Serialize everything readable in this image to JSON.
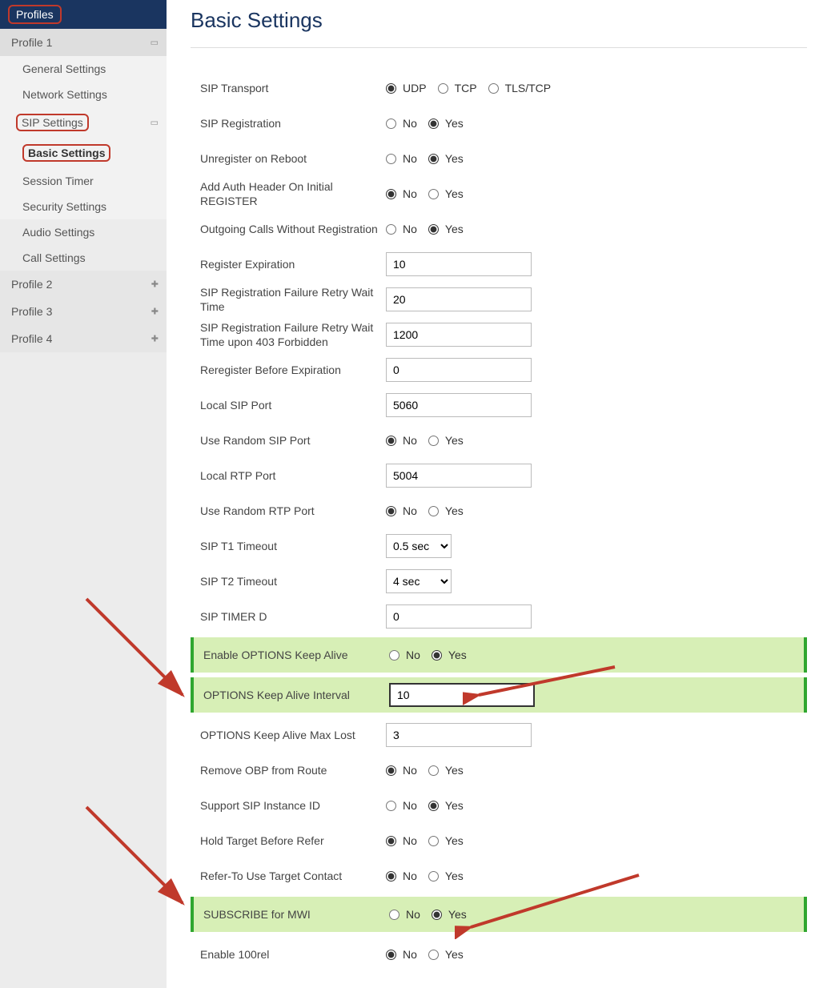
{
  "sidebar": {
    "header": "Profiles",
    "profile1": "Profile 1",
    "general": "General Settings",
    "network": "Network Settings",
    "sip": "SIP Settings",
    "basic": "Basic Settings",
    "session": "Session Timer",
    "security": "Security Settings",
    "audio": "Audio Settings",
    "call": "Call Settings",
    "profile2": "Profile 2",
    "profile3": "Profile 3",
    "profile4": "Profile 4"
  },
  "page": {
    "title": "Basic Settings"
  },
  "labels": {
    "no": "No",
    "yes": "Yes",
    "udp": "UDP",
    "tcp": "TCP",
    "tls": "TLS/TCP"
  },
  "rows": {
    "sip_transport": "SIP Transport",
    "sip_registration": "SIP Registration",
    "unregister_reboot": "Unregister on Reboot",
    "add_auth_header": "Add Auth Header On Initial REGISTER",
    "outgoing_calls": "Outgoing Calls Without Registration",
    "register_expiration": "Register Expiration",
    "reg_fail_retry": "SIP Registration Failure Retry Wait Time",
    "reg_fail_retry_403": "SIP Registration Failure Retry Wait Time upon 403 Forbidden",
    "reregister_before": "Reregister Before Expiration",
    "local_sip_port": "Local SIP Port",
    "use_random_sip": "Use Random SIP Port",
    "local_rtp_port": "Local RTP Port",
    "use_random_rtp": "Use Random RTP Port",
    "sip_t1": "SIP T1 Timeout",
    "sip_t2": "SIP T2 Timeout",
    "sip_timer_d": "SIP TIMER D",
    "enable_options": "Enable OPTIONS Keep Alive",
    "options_interval": "OPTIONS Keep Alive Interval",
    "options_max_lost": "OPTIONS Keep Alive Max Lost",
    "remove_obp": "Remove OBP from Route",
    "support_sip_instance": "Support SIP Instance ID",
    "hold_target": "Hold Target Before Refer",
    "refer_to": "Refer-To Use Target Contact",
    "subscribe_mwi": "SUBSCRIBE for MWI",
    "enable_100rel": "Enable 100rel"
  },
  "values": {
    "register_expiration": "10",
    "reg_fail_retry": "20",
    "reg_fail_retry_403": "1200",
    "reregister_before": "0",
    "local_sip_port": "5060",
    "local_rtp_port": "5004",
    "sip_t1": "0.5 sec",
    "sip_t2": "4 sec",
    "sip_timer_d": "0",
    "options_interval": "10",
    "options_max_lost": "3"
  },
  "selections": {
    "sip_transport": "UDP",
    "sip_registration": "Yes",
    "unregister_reboot": "Yes",
    "add_auth_header": "No",
    "outgoing_calls": "Yes",
    "use_random_sip": "No",
    "use_random_rtp": "No",
    "enable_options": "Yes",
    "remove_obp": "No",
    "support_sip_instance": "Yes",
    "hold_target": "No",
    "refer_to": "No",
    "subscribe_mwi": "Yes",
    "enable_100rel": "No"
  }
}
